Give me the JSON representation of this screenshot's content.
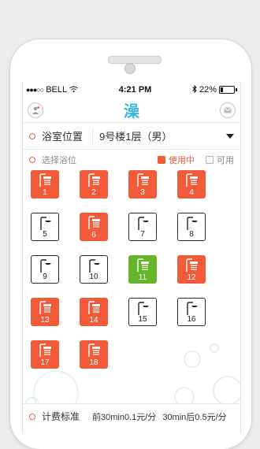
{
  "status_bar": {
    "carrier": "BELL",
    "time": "4:21 PM",
    "battery": "22%"
  },
  "appbar": {
    "logo": "澡",
    "left_icon": "user-icon",
    "right_icon": "mail-icon"
  },
  "location": {
    "label": "浴室位置",
    "value": "9号楼1层（男）"
  },
  "picker": {
    "label": "选择浴位",
    "legend_used": "使用中",
    "legend_free": "可用"
  },
  "stalls": [
    {
      "num": "1",
      "state": "used"
    },
    {
      "num": "2",
      "state": "used"
    },
    {
      "num": "3",
      "state": "used"
    },
    {
      "num": "4",
      "state": "used"
    },
    {
      "num": "5",
      "state": "free"
    },
    {
      "num": "6",
      "state": "used"
    },
    {
      "num": "7",
      "state": "free"
    },
    {
      "num": "8",
      "state": "free"
    },
    {
      "num": "9",
      "state": "free"
    },
    {
      "num": "10",
      "state": "free"
    },
    {
      "num": "11",
      "state": "active"
    },
    {
      "num": "12",
      "state": "used"
    },
    {
      "num": "13",
      "state": "used"
    },
    {
      "num": "14",
      "state": "used"
    },
    {
      "num": "15",
      "state": "free"
    },
    {
      "num": "16",
      "state": "free"
    },
    {
      "num": "17",
      "state": "used"
    },
    {
      "num": "18",
      "state": "used"
    }
  ],
  "pricing": {
    "label": "计费标准",
    "tier1": "前30min0.1元/分",
    "tier2": "30min后0.5元/分"
  },
  "colors": {
    "used": "#f25b3a",
    "active": "#67b42b",
    "accent": "#3cb4e6"
  }
}
